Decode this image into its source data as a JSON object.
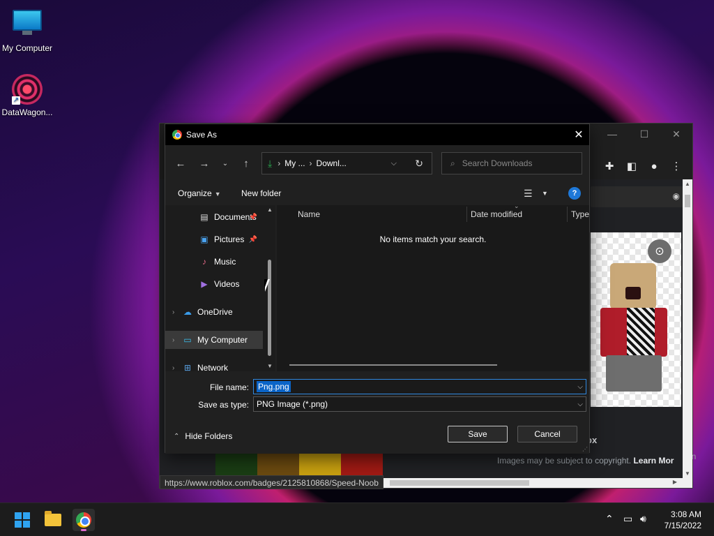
{
  "desktop": {
    "icons": [
      {
        "label": "My Computer"
      },
      {
        "label": "DataWagon..."
      }
    ]
  },
  "browser": {
    "status_url": "https://www.roblox.com/badges/2125810868/Speed-Noob",
    "copyright_prefix": "Images may be subject to copyright. ",
    "copyright_link": "Learn Mor",
    "fragment_ox": "ox",
    "fragment_in": "in"
  },
  "dialog": {
    "title": "Save As",
    "address": {
      "segment1": "My ...",
      "segment2": "Downl..."
    },
    "search_placeholder": "Search Downloads",
    "toolbar": {
      "organize": "Organize",
      "new_folder": "New folder",
      "help": "?"
    },
    "nav_items": [
      {
        "label": "Documents",
        "pinned": true
      },
      {
        "label": "Pictures",
        "pinned": true
      },
      {
        "label": "Music"
      },
      {
        "label": "Videos"
      },
      {
        "label": "OneDrive"
      },
      {
        "label": "My Computer",
        "selected": true
      },
      {
        "label": "Network"
      }
    ],
    "columns": [
      "Name",
      "Date modified",
      "Type"
    ],
    "empty_message": "No items match your search.",
    "file_name_label": "File name:",
    "file_name_value": "Png.png",
    "save_type_label": "Save as type:",
    "save_type_value": "PNG Image (*.png)",
    "hide_folders": "Hide Folders",
    "save_button": "Save",
    "cancel_button": "Cancel"
  },
  "taskbar": {
    "time": "3:08 AM",
    "date": "7/15/2022"
  },
  "colors": {
    "accent": "#0a64c8",
    "download_green": "#2aa84f"
  }
}
